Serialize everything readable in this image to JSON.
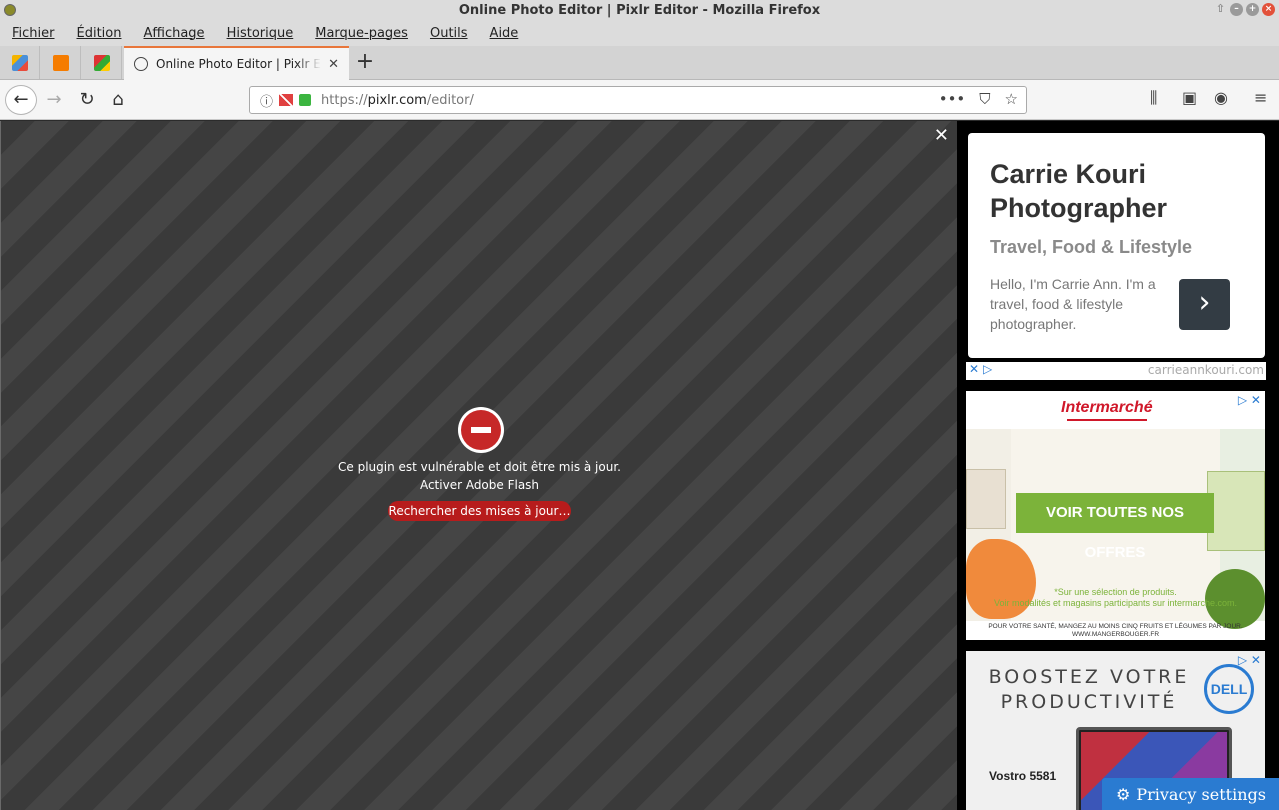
{
  "window": {
    "title": "Online Photo Editor | Pixlr Editor - Mozilla Firefox"
  },
  "menu": [
    "Fichier",
    "Édition",
    "Affichage",
    "Historique",
    "Marque-pages",
    "Outils",
    "Aide"
  ],
  "tabs": {
    "active_title": "Online Photo Editor | Pixlr Editor"
  },
  "url": {
    "scheme": "https://",
    "host": "pixlr.com",
    "path": "/editor/"
  },
  "plugin": {
    "message": "Ce plugin est vulnérable et doit être mis à jour.",
    "activate": "Activer Adobe Flash",
    "button": "Rechercher des mises à jour…"
  },
  "ads": {
    "carrie": {
      "title_line1": "Carrie Kouri",
      "title_line2": "Photographer",
      "subtitle": "Travel, Food & Lifestyle",
      "text": "Hello, I'm Carrie Ann. I'm a travel, food & lifestyle photographer.",
      "domain": "carrieannkouri.com"
    },
    "intermarche": {
      "brand": "Intermarché",
      "cta": "VOIR TOUTES NOS OFFRES",
      "fine_line1": "*Sur une sélection de produits.",
      "fine_line2": "Voir modalités et magasins participants sur intermarche.com.",
      "legal_line1": "POUR VOTRE SANTÉ, MANGEZ AU MOINS CINQ FRUITS ET LÉGUMES PAR JOUR.",
      "legal_line2": "WWW.MANGERBOUGER.FR"
    },
    "dell": {
      "headline_line1": "BOOSTEZ VOTRE",
      "headline_line2": "PRODUCTIVITÉ",
      "logo": "DELL",
      "model": "Vostro 5581"
    }
  },
  "privacy_button": "Privacy settings"
}
